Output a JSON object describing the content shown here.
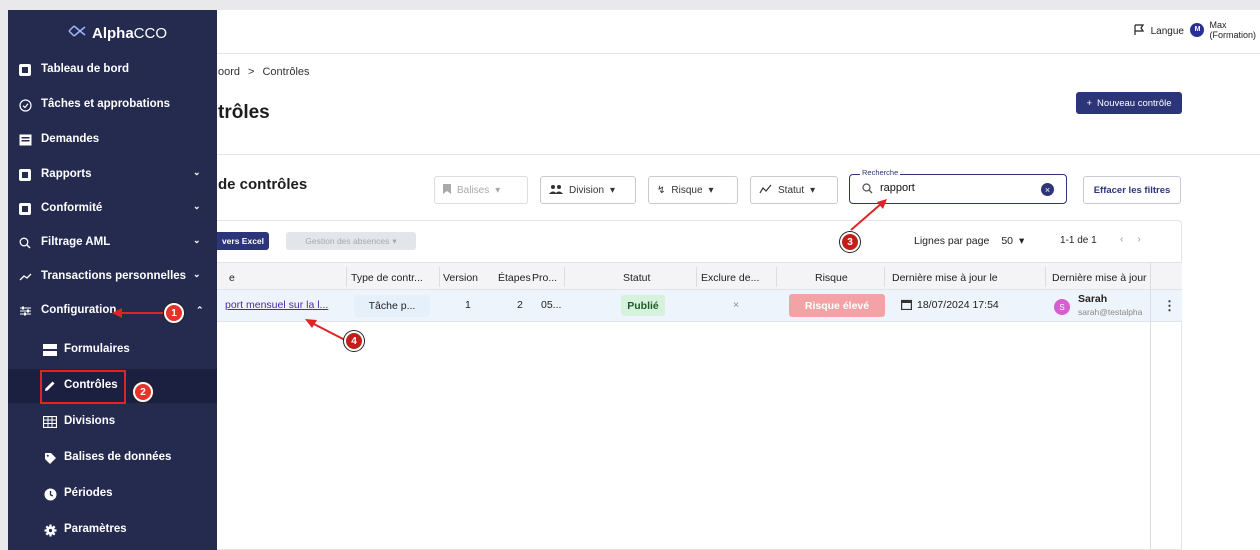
{
  "topbar": {
    "language_label": "Langue",
    "user_initial": "M",
    "user_name_line1": "Max",
    "user_name_line2": "(Formation)"
  },
  "sidebar": {
    "logo_alpha": "Alpha",
    "logo_cco": "CCO",
    "items": [
      {
        "label": "Tableau de bord",
        "icon": "dashboard-icon"
      },
      {
        "label": "Tâches et approbations",
        "icon": "check-circle-icon"
      },
      {
        "label": "Demandes",
        "icon": "inbox-icon"
      },
      {
        "label": "Rapports",
        "icon": "report-icon"
      },
      {
        "label": "Conformité",
        "icon": "compliance-icon"
      },
      {
        "label": "Filtrage AML",
        "icon": "search-icon"
      },
      {
        "label": "Transactions personnelles",
        "icon": "trend-icon"
      },
      {
        "label": "Configuration",
        "icon": "sliders-icon"
      }
    ],
    "sub_items": [
      {
        "label": "Formulaires",
        "icon": "form-icon"
      },
      {
        "label": "Contrôles",
        "icon": "pencil-icon"
      },
      {
        "label": "Divisions",
        "icon": "building-icon"
      },
      {
        "label": "Balises de données",
        "icon": "tag-icon"
      },
      {
        "label": "Périodes",
        "icon": "clock-icon"
      },
      {
        "label": "Paramètres",
        "icon": "gear-icon"
      }
    ]
  },
  "breadcrumb": {
    "parent": "oord",
    "separator": ">",
    "current": "Contrôles"
  },
  "page_title": "trôles",
  "new_button": "Nouveau contrôle",
  "section_title": "de contrôles",
  "filters": {
    "balises": "Balises",
    "division": "Division",
    "risque": "Risque",
    "statut": "Statut",
    "search_legend": "Recherche",
    "search_value": "rapport",
    "clear_filters": "Effacer les filtres"
  },
  "toolbar": {
    "excel": "vers Excel",
    "absences": "Gestion des absences"
  },
  "pager": {
    "rows_label": "Lignes par page",
    "rows_value": "50",
    "count": "1-1 de 1"
  },
  "table": {
    "headers": [
      "e",
      "Type de contr...",
      "Version",
      "Étapes",
      "Pro...",
      "Statut",
      "Exclure de...",
      "Risque",
      "Dernière mise à jour le",
      "Dernière mise à jour"
    ],
    "row": {
      "name": "port mensuel sur la l...",
      "type": "Tâche p...",
      "version": "1",
      "etapes": "2",
      "pro": "05...",
      "statut": "Publié",
      "exclure": "×",
      "risque": "Risque élevé",
      "date": "18/07/2024 17:54",
      "user_initial": "S",
      "user_name": "Sarah",
      "user_email": "sarah@testalpha"
    }
  },
  "markers": [
    "1",
    "2",
    "3",
    "4"
  ],
  "colors": {
    "sidebar": "#252a4f",
    "primary": "#2d3579",
    "accent_red": "#e5332a",
    "status_green": "#d7f2dc",
    "risk_red": "#f3a3a6"
  }
}
